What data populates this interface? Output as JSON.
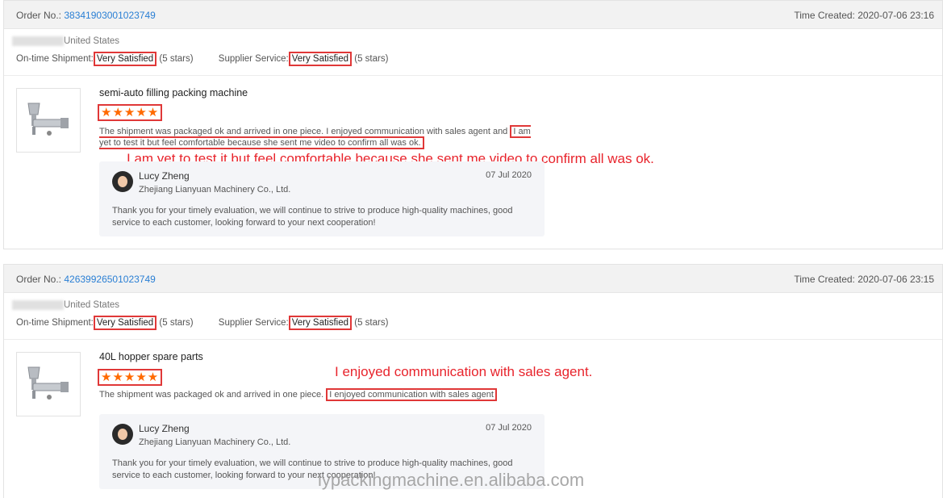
{
  "orders": [
    {
      "order_label": "Order No.:",
      "order_no": "38341903001023749",
      "time_label": "Time Created:",
      "time": "2020-07-06 23:16",
      "country": "United States",
      "shipment_label": "On-time Shipment:",
      "shipment_rating": "Very Satisfied",
      "shipment_stars": "(5 stars)",
      "service_label": "Supplier Service:",
      "service_rating": "Very Satisfied",
      "service_stars": "(5 stars)",
      "product": "semi-auto filling packing machine",
      "stars": "★★★★★",
      "review_lead": "The shipment was packaged ok and arrived in one piece. I enjoyed communication with sales agent and",
      "review_highlight": "I am yet to test it but feel comfortable because she sent me video to confirm all was ok.",
      "annotation": "I am yet to test it but feel comfortable because she sent me video to confirm all was ok.",
      "reply": {
        "name": "Lucy Zheng",
        "company": "Zhejiang Lianyuan Machinery Co., Ltd.",
        "date": "07 Jul 2020",
        "text": "Thank you for your timely evaluation, we will continue to strive to produce high-quality machines, good service to each customer, looking forward to your next cooperation!"
      }
    },
    {
      "order_label": "Order No.:",
      "order_no": "42639926501023749",
      "time_label": "Time Created:",
      "time": "2020-07-06 23:15",
      "country": "United States",
      "shipment_label": "On-time Shipment:",
      "shipment_rating": "Very Satisfied",
      "shipment_stars": "(5 stars)",
      "service_label": "Supplier Service:",
      "service_rating": "Very Satisfied",
      "service_stars": "(5 stars)",
      "product": "40L hopper spare parts",
      "stars": "★★★★★",
      "review_lead": "The shipment was packaged ok and arrived in one piece.",
      "review_highlight": "I enjoyed communication with sales agent",
      "annotation": "I enjoyed communication with sales agent.",
      "reply": {
        "name": "Lucy Zheng",
        "company": "Zhejiang Lianyuan Machinery Co., Ltd.",
        "date": "07 Jul 2020",
        "text": "Thank you for your timely evaluation, we will continue to strive to produce high-quality machines, good service to each customer, looking forward to your next cooperation!"
      }
    }
  ],
  "watermark": "lypackingmachine.en.alibaba.com",
  "colors": {
    "highlight_border": "#e03838",
    "annotation": "#e8242c",
    "star": "#ff6a00",
    "link": "#2a7fd4"
  },
  "icons": {
    "product_thumb": "filling-machine-icon",
    "avatar": "user-avatar"
  }
}
